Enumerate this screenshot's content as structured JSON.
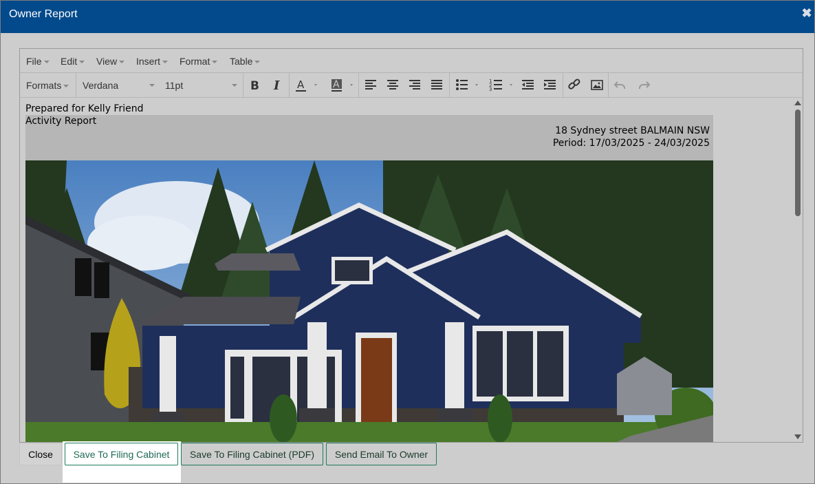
{
  "dialog": {
    "title": "Owner Report"
  },
  "editor": {
    "menu": [
      {
        "label": "File"
      },
      {
        "label": "Edit"
      },
      {
        "label": "View"
      },
      {
        "label": "Insert"
      },
      {
        "label": "Format"
      },
      {
        "label": "Table"
      }
    ],
    "toolbar": {
      "formats_label": "Formats",
      "font_family": "Verdana",
      "font_size": "11pt"
    },
    "content": {
      "prepared_for": "Prepared for Kelly Friend",
      "report_type": "Activity Report",
      "address": "18 Sydney street BALMAIN NSW",
      "period": "Period: 17/03/2025 - 24/03/2025"
    }
  },
  "buttons": {
    "close": "Close",
    "save_filing": "Save To Filing Cabinet",
    "save_filing_pdf": "Save To Filing Cabinet (PDF)",
    "send_email": "Send Email To Owner"
  },
  "colors": {
    "titlebar": "#034a8c",
    "button_border": "#1e7a5a",
    "house_siding": "#1f2f5c"
  },
  "icons": {
    "close": "close-icon",
    "bold": "bold-icon",
    "italic": "italic-icon",
    "text_color": "text-color-icon",
    "background_color": "background-color-icon",
    "align_left": "align-left-icon",
    "align_center": "align-center-icon",
    "align_right": "align-right-icon",
    "align_justify": "align-justify-icon",
    "bullet_list": "bullet-list-icon",
    "numbered_list": "numbered-list-icon",
    "outdent": "outdent-icon",
    "indent": "indent-icon",
    "link": "link-icon",
    "image": "image-icon",
    "undo": "undo-icon",
    "redo": "redo-icon"
  }
}
